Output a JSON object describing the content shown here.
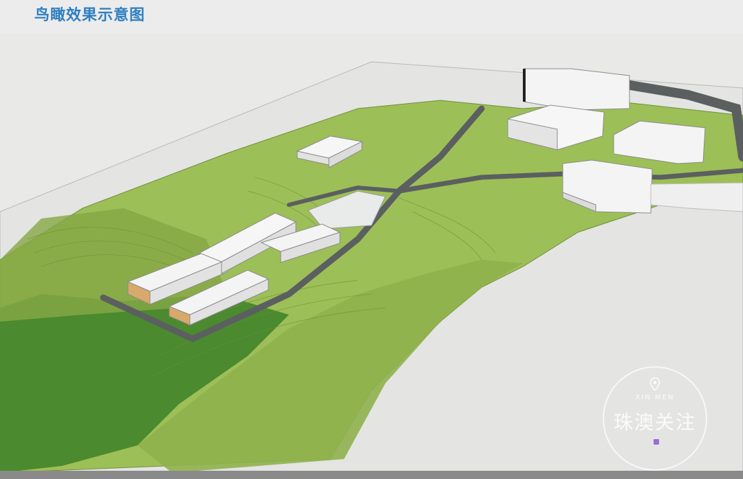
{
  "page": {
    "title": "鸟瞰效果示意图"
  },
  "watermark": {
    "subtitle": "XIN MEN",
    "name": "珠澳关注"
  },
  "colors": {
    "title": "#2f7fc1",
    "terrain_green": "#9dbf57",
    "dark_green": "#4b8a2e",
    "road": "#5b5f60",
    "building": "#f4f4f4",
    "ground": "#e9e9e8"
  },
  "icons": {
    "watermark_pin": "map-pin-icon"
  }
}
